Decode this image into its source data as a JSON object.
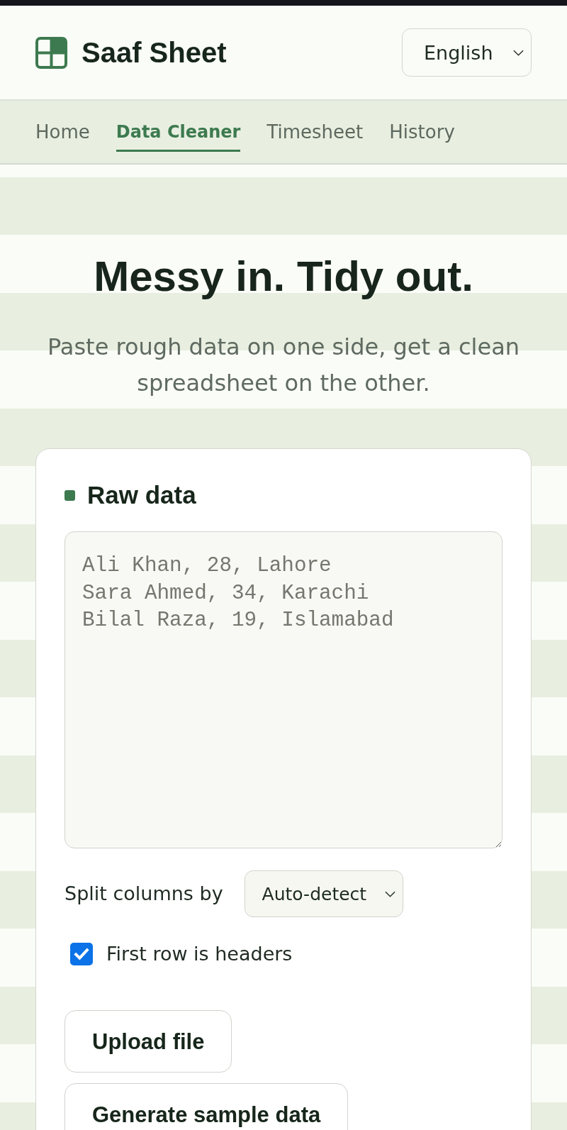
{
  "header": {
    "brand": "Saaf Sheet",
    "language": "English"
  },
  "nav": {
    "tabs": [
      {
        "label": "Home",
        "selected": false
      },
      {
        "label": "Data Cleaner",
        "selected": true
      },
      {
        "label": "Timesheet",
        "selected": false
      },
      {
        "label": "History",
        "selected": false
      }
    ]
  },
  "hero": {
    "title": "Messy in. Tidy out.",
    "subtitle": "Paste rough data on one side, get a clean spreadsheet on the other."
  },
  "raw_data": {
    "title": "Raw data",
    "input": {
      "placeholder": "Ali Khan, 28, Lahore\nSara Ahmed, 34, Karachi\nBilal Raza, 19, Islamabad"
    },
    "split": {
      "label": "Split columns by",
      "value": "Auto-detect"
    },
    "first_row_headers": {
      "label": "First row is headers",
      "checked": true
    },
    "buttons": [
      "Upload file",
      "Generate sample data"
    ]
  }
}
